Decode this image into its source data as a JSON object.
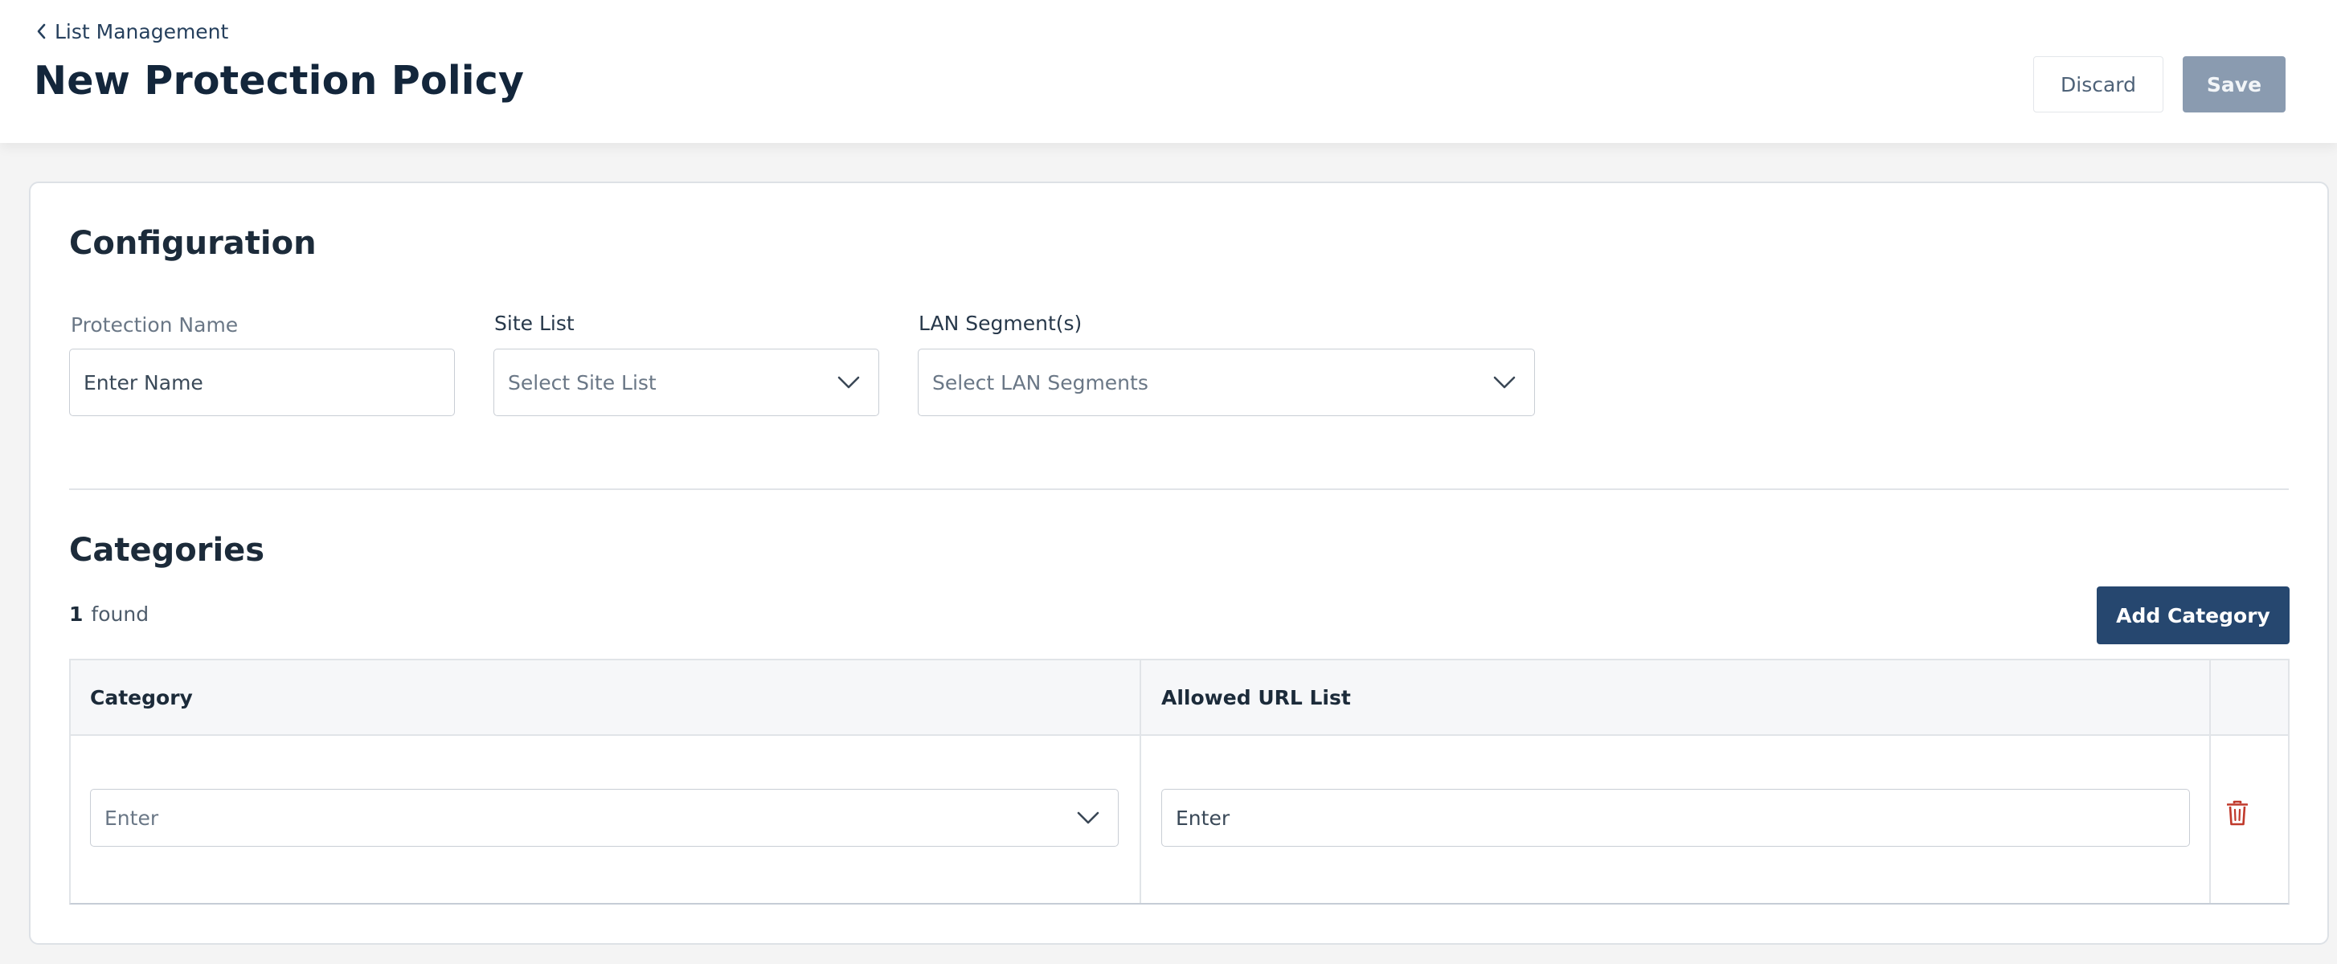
{
  "header": {
    "back_label": "List Management",
    "title": "New Protection Policy",
    "discard_label": "Discard",
    "save_label": "Save"
  },
  "configuration": {
    "title": "Configuration",
    "protection_name": {
      "label": "Protection Name",
      "placeholder": "Enter Name"
    },
    "site_list": {
      "label": "Site List",
      "placeholder": "Select Site List"
    },
    "lan_segments": {
      "label": "LAN Segment(s)",
      "placeholder": "Select LAN Segments"
    }
  },
  "categories": {
    "title": "Categories",
    "count": "1",
    "count_suffix": "found",
    "add_label": "Add Category",
    "columns": [
      "Category",
      "Allowed URL List"
    ],
    "rows": [
      {
        "category_placeholder": "Enter",
        "url_placeholder": "Enter"
      }
    ]
  },
  "colors": {
    "primary": "#26476f",
    "save_disabled": "#8a9bb0",
    "delete": "#c0392b",
    "title": "#13263b"
  },
  "icons": {
    "back": "chevron-left-icon",
    "dropdown": "chevron-down-icon",
    "delete": "trash-icon"
  }
}
